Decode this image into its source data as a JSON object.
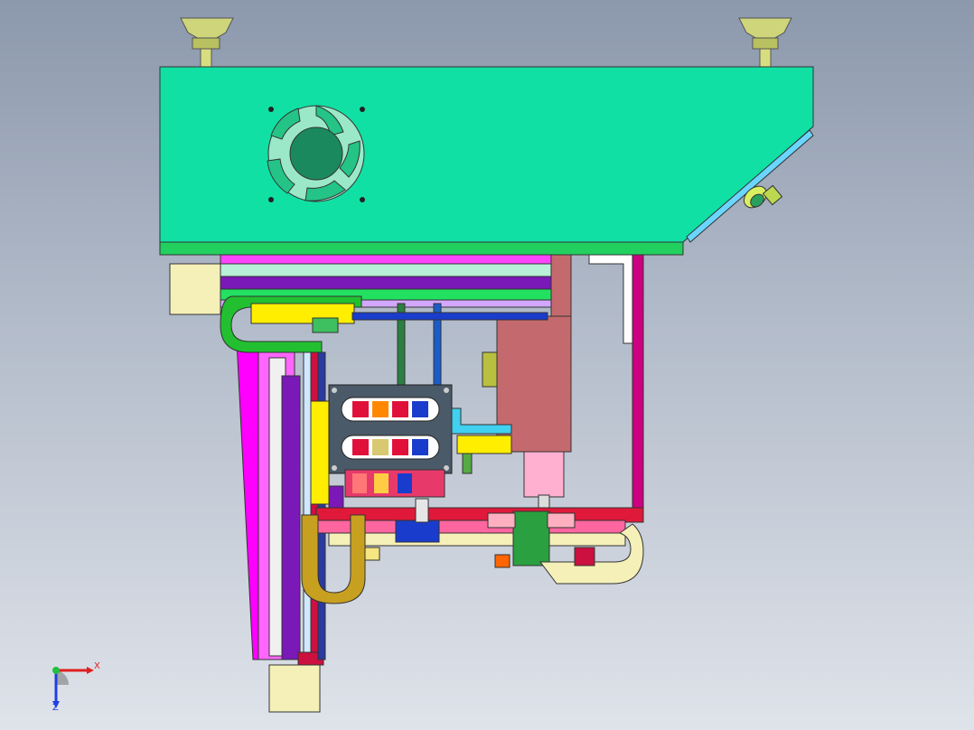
{
  "viewport": {
    "background_top": "#8c98ac",
    "background_bottom": "#dfe3ea"
  },
  "colors": {
    "housing": "#11e0a4",
    "fan": "#1a8a5e",
    "frame_pink": "#ff00ff",
    "frame_purple": "#7a18b8",
    "yellow": "#ffee00",
    "dark_gray": "#4a5a68",
    "crimson": "#cc1040",
    "salmon": "#c46a6e",
    "olive": "#c8a020",
    "cream": "#f5f0b8",
    "blue": "#1a3ccc"
  },
  "triad": {
    "x_label": "X",
    "z_label": "Z",
    "x_color": "#e02020",
    "y_color": "#20c040",
    "z_color": "#2040e0"
  }
}
